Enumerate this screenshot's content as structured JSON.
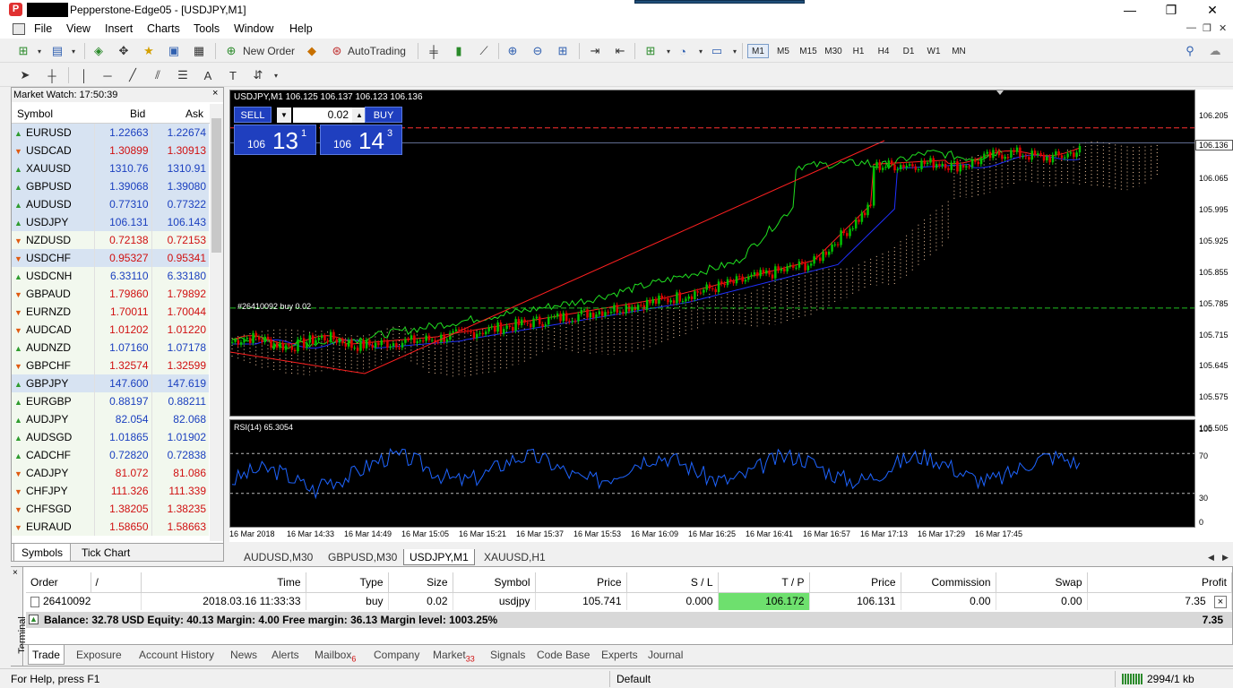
{
  "window": {
    "title": "Pepperstone-Edge05 - [USDJPY,M1]",
    "minimize": "—",
    "maximize": "❐",
    "close": "✕"
  },
  "menu": [
    "File",
    "View",
    "Insert",
    "Charts",
    "Tools",
    "Window",
    "Help"
  ],
  "toolbar": {
    "new_order": "New Order",
    "autotrading": "AutoTrading",
    "timeframes": [
      "M1",
      "M5",
      "M15",
      "M30",
      "H1",
      "H4",
      "D1",
      "W1",
      "MN"
    ],
    "active_timeframe": "M1"
  },
  "market_watch": {
    "header": "Market Watch: 17:50:39",
    "close": "×",
    "columns": {
      "symbol": "Symbol",
      "bid": "Bid",
      "ask": "Ask"
    },
    "rows": [
      {
        "symbol": "EURUSD",
        "bid": "1.22663",
        "ask": "1.22674",
        "dir": "up",
        "hl": true
      },
      {
        "symbol": "USDCAD",
        "bid": "1.30899",
        "ask": "1.30913",
        "dir": "down",
        "hl": true
      },
      {
        "symbol": "XAUUSD",
        "bid": "1310.76",
        "ask": "1310.91",
        "dir": "up",
        "hl": true
      },
      {
        "symbol": "GBPUSD",
        "bid": "1.39068",
        "ask": "1.39080",
        "dir": "up",
        "hl": true
      },
      {
        "symbol": "AUDUSD",
        "bid": "0.77310",
        "ask": "0.77322",
        "dir": "up",
        "hl": true
      },
      {
        "symbol": "USDJPY",
        "bid": "106.131",
        "ask": "106.143",
        "dir": "up",
        "hl": true
      },
      {
        "symbol": "NZDUSD",
        "bid": "0.72138",
        "ask": "0.72153",
        "dir": "down",
        "hl": false
      },
      {
        "symbol": "USDCHF",
        "bid": "0.95327",
        "ask": "0.95341",
        "dir": "down",
        "hl": true
      },
      {
        "symbol": "USDCNH",
        "bid": "6.33110",
        "ask": "6.33180",
        "dir": "up",
        "hl": false
      },
      {
        "symbol": "GBPAUD",
        "bid": "1.79860",
        "ask": "1.79892",
        "dir": "down",
        "hl": false
      },
      {
        "symbol": "EURNZD",
        "bid": "1.70011",
        "ask": "1.70044",
        "dir": "down",
        "hl": false
      },
      {
        "symbol": "AUDCAD",
        "bid": "1.01202",
        "ask": "1.01220",
        "dir": "down",
        "hl": false
      },
      {
        "symbol": "AUDNZD",
        "bid": "1.07160",
        "ask": "1.07178",
        "dir": "up",
        "hl": false
      },
      {
        "symbol": "GBPCHF",
        "bid": "1.32574",
        "ask": "1.32599",
        "dir": "down",
        "hl": false
      },
      {
        "symbol": "GBPJPY",
        "bid": "147.600",
        "ask": "147.619",
        "dir": "up",
        "hl": true
      },
      {
        "symbol": "EURGBP",
        "bid": "0.88197",
        "ask": "0.88211",
        "dir": "up",
        "hl": false
      },
      {
        "symbol": "AUDJPY",
        "bid": "82.054",
        "ask": "82.068",
        "dir": "up",
        "hl": false
      },
      {
        "symbol": "AUDSGD",
        "bid": "1.01865",
        "ask": "1.01902",
        "dir": "up",
        "hl": false
      },
      {
        "symbol": "CADCHF",
        "bid": "0.72820",
        "ask": "0.72838",
        "dir": "up",
        "hl": false
      },
      {
        "symbol": "CADJPY",
        "bid": "81.072",
        "ask": "81.086",
        "dir": "down",
        "hl": false
      },
      {
        "symbol": "CHFJPY",
        "bid": "111.326",
        "ask": "111.339",
        "dir": "down",
        "hl": false
      },
      {
        "symbol": "CHFSGD",
        "bid": "1.38205",
        "ask": "1.38235",
        "dir": "down",
        "hl": false
      },
      {
        "symbol": "EURAUD",
        "bid": "1.58650",
        "ask": "1.58663",
        "dir": "down",
        "hl": false
      }
    ],
    "tabs": [
      "Symbols",
      "Tick Chart"
    ],
    "active_tab": "Symbols"
  },
  "chart": {
    "header": "USDJPY,M1  106.125 106.137 106.123 106.136",
    "order_line_label": "#26410092 buy 0.02",
    "current_price_label": "106.136",
    "price_ticks": [
      "106.205",
      "106.065",
      "105.995",
      "105.925",
      "105.855",
      "105.785",
      "105.715",
      "105.645",
      "105.575",
      "105.505"
    ],
    "time_ticks": [
      "16 Mar 2018",
      "16 Mar 14:33",
      "16 Mar 14:49",
      "16 Mar 15:05",
      "16 Mar 15:21",
      "16 Mar 15:37",
      "16 Mar 15:53",
      "16 Mar 16:09",
      "16 Mar 16:25",
      "16 Mar 16:41",
      "16 Mar 16:57",
      "16 Mar 17:13",
      "16 Mar 17:29",
      "16 Mar 17:45"
    ],
    "rsi_label": "RSI(14) 65.3054",
    "rsi_ticks": [
      "100",
      "70",
      "30",
      "0"
    ],
    "one_click": {
      "sell": "SELL",
      "buy": "BUY",
      "lot": "0.02",
      "bid_big": "106",
      "bid_mid": "13",
      "bid_sup": "1",
      "ask_big": "106",
      "ask_mid": "14",
      "ask_sup": "3"
    },
    "tabs": [
      "AUDUSD,M30",
      "GBPUSD,M30",
      "USDJPY,M1",
      "XAUUSD,H1"
    ],
    "active_tab": "USDJPY,M1",
    "colors": {
      "bull": "#00c000",
      "bear": "#e00000",
      "fast_ma": "#ff2020",
      "slow_ma": "#2030ff",
      "chikou": "#20e020",
      "cloud": "#f4c8a0",
      "rsi": "#1e64ff"
    }
  },
  "terminal": {
    "label": "Terminal",
    "columns": [
      "Order",
      "/",
      "Time",
      "Type",
      "Size",
      "Symbol",
      "Price",
      "S / L",
      "T / P",
      "Price",
      "Commission",
      "Swap",
      "Profit"
    ],
    "order": {
      "id": "26410092",
      "time": "2018.03.16 11:33:33",
      "type": "buy",
      "size": "0.02",
      "symbol": "usdjpy",
      "price": "105.741",
      "sl": "0.000",
      "tp": "106.172",
      "cur": "106.131",
      "commission": "0.00",
      "swap": "0.00",
      "profit": "7.35"
    },
    "balance_line": "Balance: 32.78 USD  Equity: 40.13  Margin: 4.00  Free margin: 36.13  Margin level: 1003.25%",
    "balance_profit": "7.35",
    "tabs": [
      {
        "label": "Trade",
        "badge": ""
      },
      {
        "label": "Exposure",
        "badge": ""
      },
      {
        "label": "Account History",
        "badge": ""
      },
      {
        "label": "News",
        "badge": ""
      },
      {
        "label": "Alerts",
        "badge": ""
      },
      {
        "label": "Mailbox",
        "badge": "6"
      },
      {
        "label": "Company",
        "badge": ""
      },
      {
        "label": "Market",
        "badge": "33"
      },
      {
        "label": "Signals",
        "badge": ""
      },
      {
        "label": "Code Base",
        "badge": ""
      },
      {
        "label": "Experts",
        "badge": ""
      },
      {
        "label": "Journal",
        "badge": ""
      }
    ],
    "active_tab": "Trade"
  },
  "status": {
    "help": "For Help, press F1",
    "profile": "Default",
    "traffic": "2994/1 kb"
  }
}
